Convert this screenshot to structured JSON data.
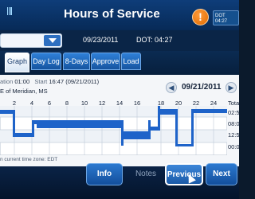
{
  "app": {
    "title": "Hours of Service",
    "alert_glyph": "!"
  },
  "header": {
    "dot_label": "DOT",
    "dot_time": "04:27",
    "date": "09/23/2011",
    "dot_clock": "DOT: 04:27"
  },
  "tabs": [
    {
      "label": "Graph",
      "active": true
    },
    {
      "label": "Day Log",
      "active": false
    },
    {
      "label": "8-Days",
      "active": false
    },
    {
      "label": "Approve",
      "active": false
    },
    {
      "label": "Load",
      "active": false
    }
  ],
  "graph": {
    "duration_label": "ation",
    "duration_value": "01:00",
    "start_label": "Start",
    "start_value": "16:47 (09/21/2011)",
    "location": "E of Meridian, MS",
    "selected_date": "09/21/2011",
    "prev_glyph": "◀",
    "next_glyph": "▶",
    "hour_labels": [
      "2",
      "4",
      "6",
      "8",
      "10",
      "12",
      "14",
      "16",
      "18",
      "20",
      "22",
      "24"
    ],
    "totals_header": "Tota",
    "totals": [
      "02:5",
      "08:0",
      "12:5",
      "00:0"
    ],
    "timezone_note": "n current time zone: EDT"
  },
  "buttons": {
    "info": "Info",
    "notes": "Notes",
    "previous": "Previous",
    "next": "Next"
  },
  "colors": {
    "accent": "#1b6fd0",
    "line": "#1e63c9",
    "panel": "#f4f6f9"
  }
}
